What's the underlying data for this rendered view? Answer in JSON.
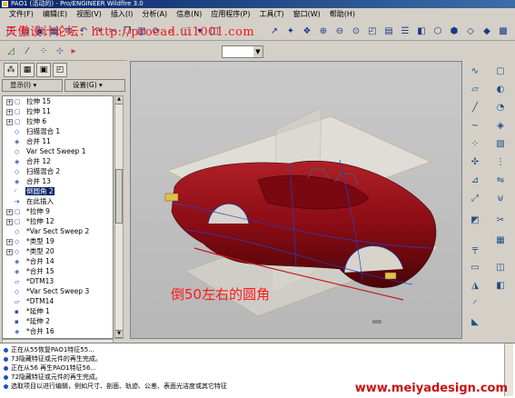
{
  "window": {
    "title": "PAO1 (活动的) - Pro/ENGINEER Wildfire 3.0"
  },
  "menubar": {
    "items": [
      "文件(F)",
      "编辑(E)",
      "视图(V)",
      "插入(I)",
      "分析(A)",
      "信息(N)",
      "应用程序(P)",
      "工具(T)",
      "窗口(W)",
      "帮助(H)"
    ]
  },
  "forum_overlay": "天傲设计论坛：http://proead.ui1001.com",
  "panel": {
    "show_label": "显示(I) ▾",
    "settings_label": "设置(G) ▾"
  },
  "tree": {
    "items": [
      {
        "label": "拉伸 15",
        "expand": "+",
        "icon": "▢",
        "indent": 0
      },
      {
        "label": "拉伸 11",
        "expand": "+",
        "icon": "▢",
        "indent": 0
      },
      {
        "label": "拉伸 6",
        "expand": "+",
        "icon": "▢",
        "indent": 0
      },
      {
        "label": "扫描混合 1",
        "expand": "",
        "icon": "◇",
        "indent": 1
      },
      {
        "label": "合并 11",
        "expand": "",
        "icon": "◈",
        "indent": 1
      },
      {
        "label": "Var Sect Sweep 1",
        "expand": "",
        "icon": "◇",
        "indent": 1
      },
      {
        "label": "合并 12",
        "expand": "",
        "icon": "◈",
        "indent": 1
      },
      {
        "label": "扫描混合 2",
        "expand": "",
        "icon": "◇",
        "indent": 1
      },
      {
        "label": "合并 13",
        "expand": "",
        "icon": "◈",
        "indent": 1
      },
      {
        "label": "倒圆角 2",
        "expand": "",
        "icon": "◜",
        "indent": 1,
        "selected": true
      },
      {
        "label": "在此插入",
        "expand": "",
        "icon": "➔",
        "indent": 1
      },
      {
        "label": "*拉伸 9",
        "expand": "+",
        "icon": "▢",
        "indent": 0
      },
      {
        "label": "*拉伸 12",
        "expand": "+",
        "icon": "▢",
        "indent": 0
      },
      {
        "label": "*Var Sect Sweep 2",
        "expand": "",
        "icon": "◇",
        "indent": 1
      },
      {
        "label": "*类型 19",
        "expand": "+",
        "icon": "◇",
        "indent": 0
      },
      {
        "label": "*类型 20",
        "expand": "+",
        "icon": "◇",
        "indent": 0
      },
      {
        "label": "*合并 14",
        "expand": "",
        "icon": "◈",
        "indent": 1
      },
      {
        "label": "*合并 15",
        "expand": "",
        "icon": "◈",
        "indent": 1
      },
      {
        "label": "*DTM13",
        "expand": "",
        "icon": "▱",
        "indent": 1
      },
      {
        "label": "*Var Sect Sweep 3",
        "expand": "",
        "icon": "◇",
        "indent": 1
      },
      {
        "label": "*DTM14",
        "expand": "",
        "icon": "▱",
        "indent": 1
      },
      {
        "label": "*延伸 1",
        "expand": "",
        "icon": "▪",
        "indent": 1
      },
      {
        "label": "*延伸 2",
        "expand": "",
        "icon": "▪",
        "indent": 1
      },
      {
        "label": "*合并 16",
        "expand": "",
        "icon": "◈",
        "indent": 1
      }
    ]
  },
  "annotation": "倒50左右的圆角",
  "messages": [
    "正在从55恢复PAO1特征55...",
    "73隐藏特征或元件的再生完成。",
    "正在从56 再生PAO1特征56...",
    "72隐藏特征或元件的再生完成。",
    "选取项目以进行编辑，例如尺寸、剖面、轨迹、公差、表面光洁度或其它特征"
  ],
  "watermark": "www.meiyadesign.com",
  "colors": {
    "car_body": "#8a0c14",
    "selection": "#0a246a",
    "annotation": "#ff1818",
    "titlebar": "#0a246a"
  }
}
